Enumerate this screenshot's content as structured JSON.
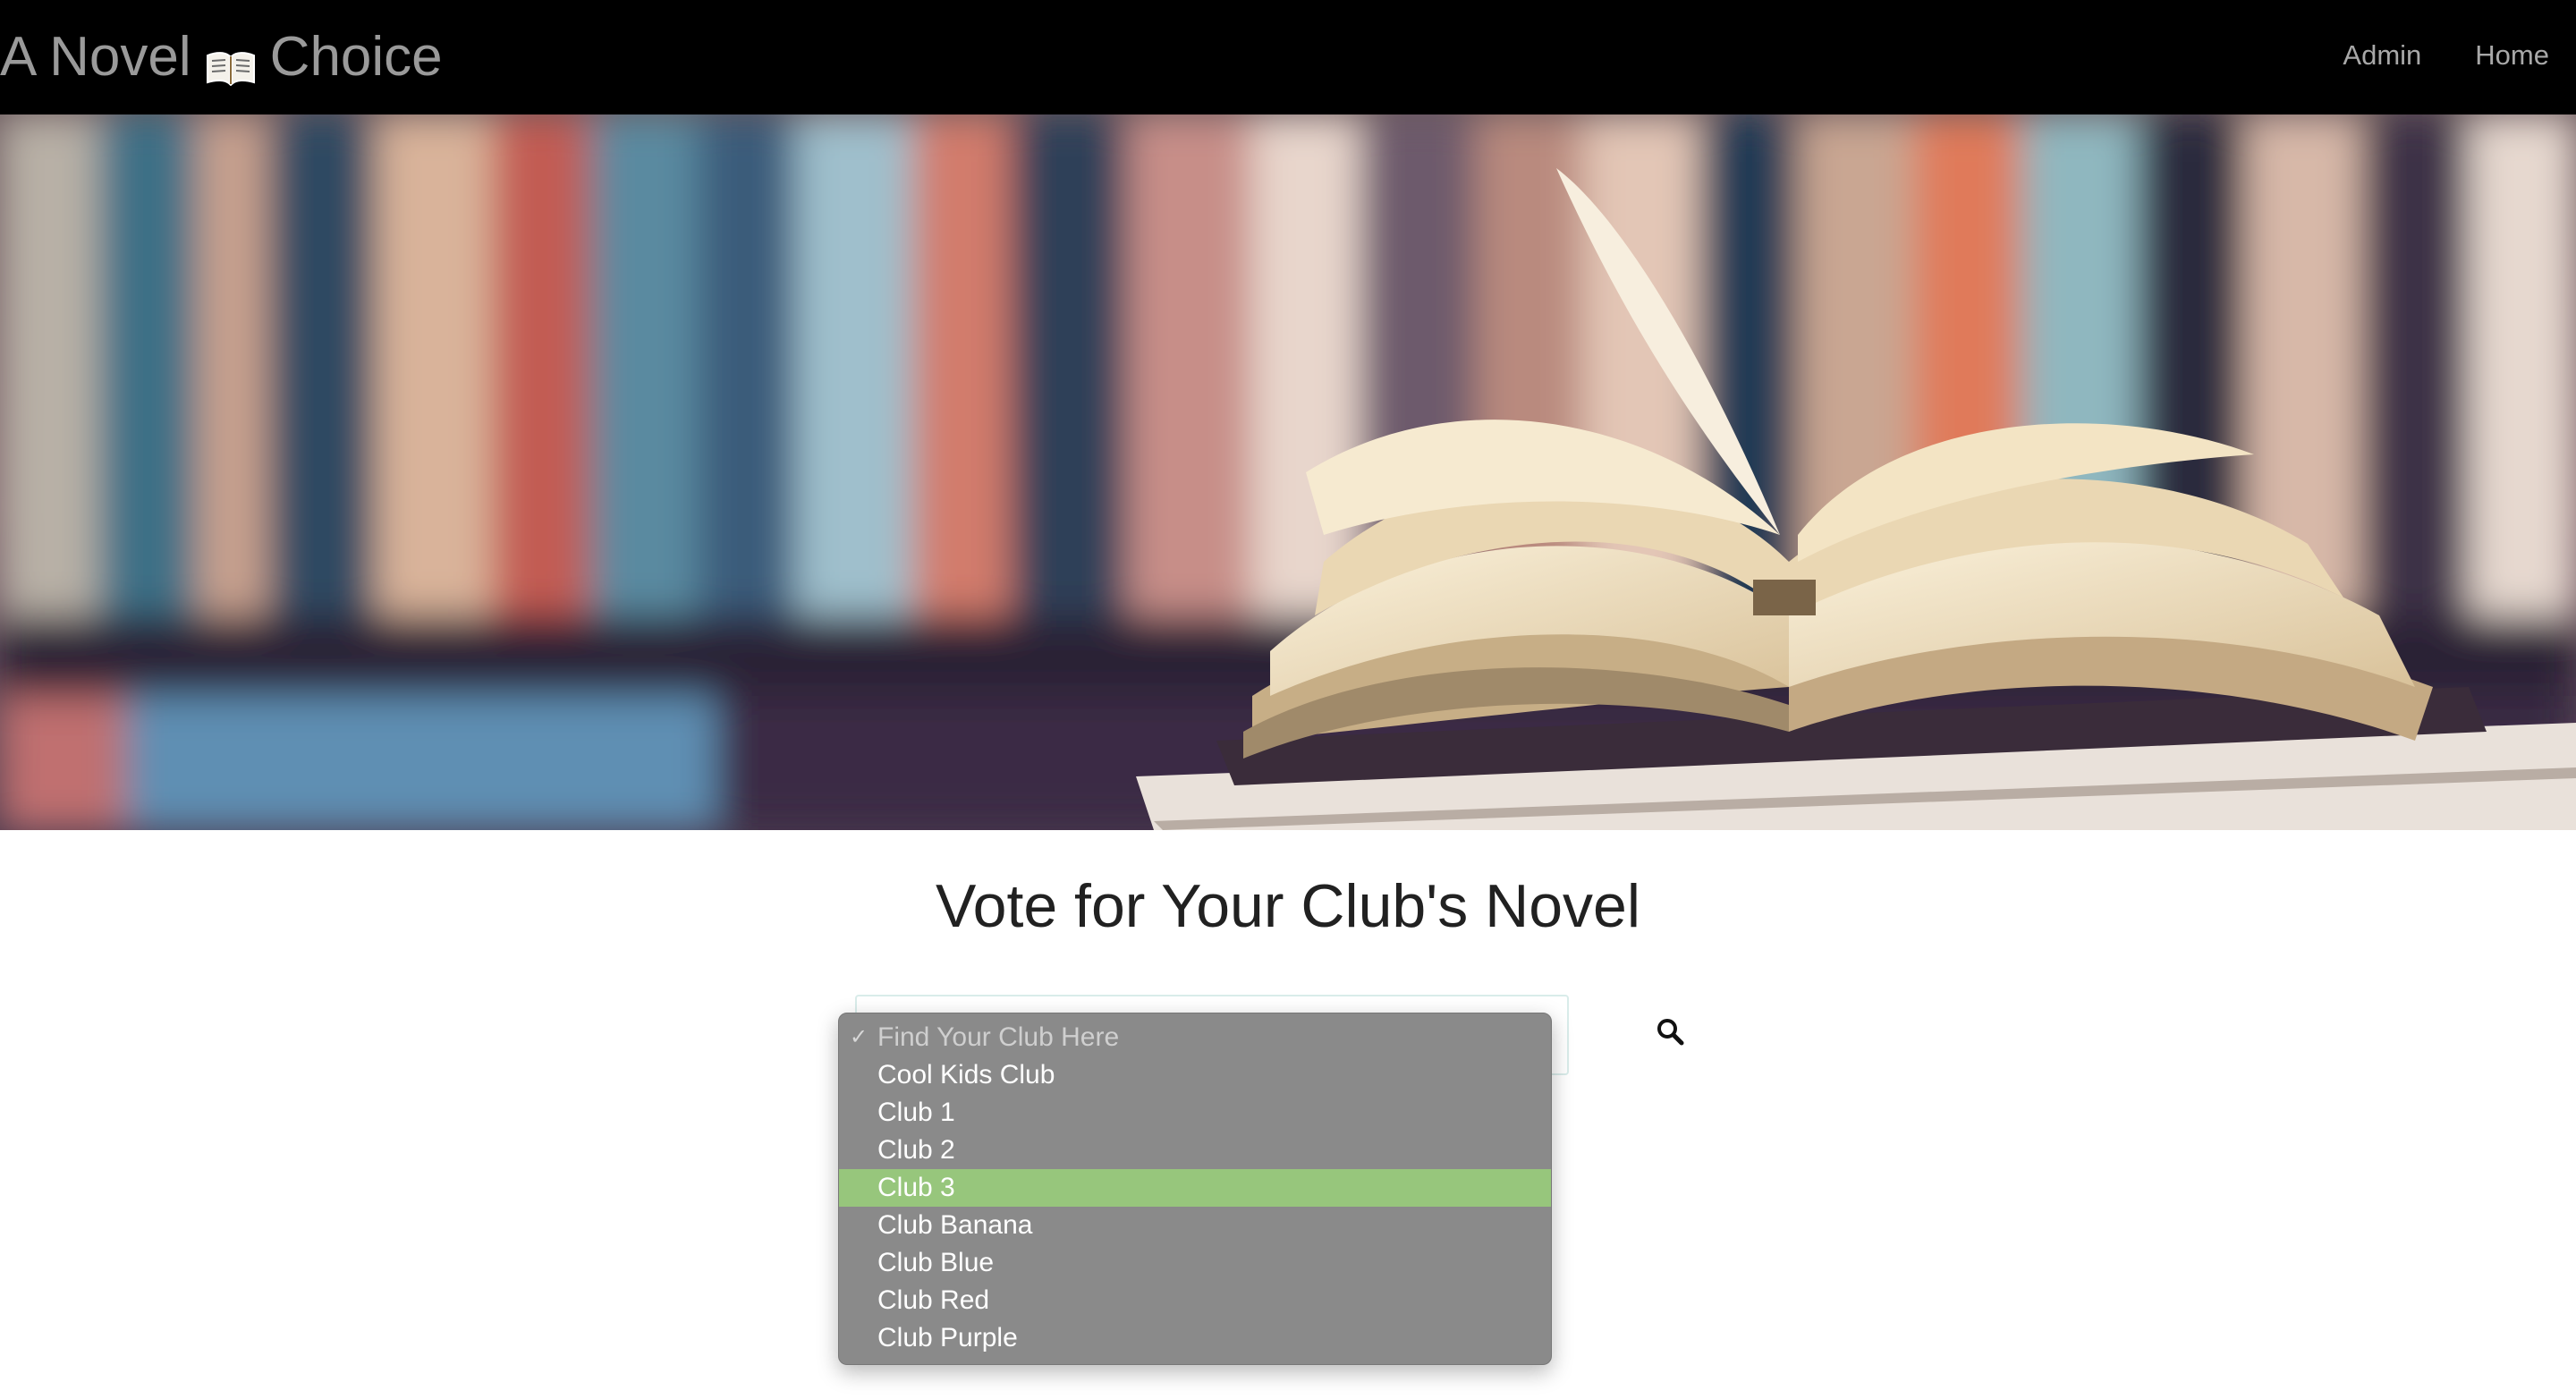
{
  "navbar": {
    "brand_left": "A Novel",
    "brand_icon": "open-book-icon",
    "brand_right": "Choice",
    "links": [
      "Admin",
      "Home"
    ]
  },
  "hero": {
    "image": "open-book-on-library-shelf-photo"
  },
  "main": {
    "heading": "Vote for Your Club's Novel",
    "club_select": {
      "placeholder": "Find Your Club Here",
      "options": [
        "Find Your Club Here",
        "Cool Kids Club",
        "Club 1",
        "Club 2",
        "Club 3",
        "Club Banana",
        "Club Blue",
        "Club Red",
        "Club Purple"
      ],
      "checked": "Find Your Club Here",
      "highlighted": "Club 3"
    },
    "search_icon": "magnifier-icon"
  },
  "colors": {
    "navbar_bg": "#000000",
    "dropdown_bg": "#8a8a8a",
    "highlight": "#97c67c",
    "heading_text": "#212121"
  }
}
